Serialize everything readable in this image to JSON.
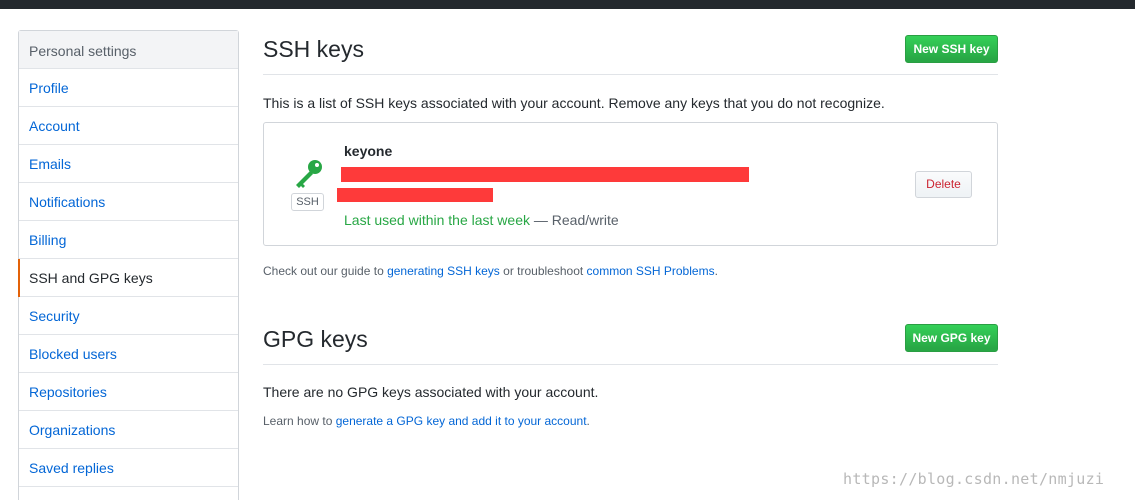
{
  "sidebar": {
    "header": "Personal settings",
    "items": [
      {
        "label": "Profile"
      },
      {
        "label": "Account"
      },
      {
        "label": "Emails"
      },
      {
        "label": "Notifications"
      },
      {
        "label": "Billing"
      },
      {
        "label": "SSH and GPG keys",
        "active": true
      },
      {
        "label": "Security"
      },
      {
        "label": "Blocked users"
      },
      {
        "label": "Repositories"
      },
      {
        "label": "Organizations"
      },
      {
        "label": "Saved replies"
      }
    ]
  },
  "ssh": {
    "title": "SSH keys",
    "new_button": "New SSH key",
    "description": "This is a list of SSH keys associated with your account. Remove any keys that you do not recognize.",
    "key": {
      "name": "keyone",
      "badge": "SSH",
      "last_used": "Last used within the last week",
      "separator": " — ",
      "access": "Read/write",
      "delete_label": "Delete"
    },
    "guide": {
      "prefix": "Check out our guide to ",
      "link1": "generating SSH keys",
      "middle": " or troubleshoot ",
      "link2": "common SSH Problems",
      "suffix": "."
    }
  },
  "gpg": {
    "title": "GPG keys",
    "new_button": "New GPG key",
    "empty": "There are no GPG keys associated with your account.",
    "learn": {
      "prefix": "Learn how to ",
      "link": "generate a GPG key and add it to your account",
      "suffix": "."
    }
  },
  "watermark": "https://blog.csdn.net/nmjuzi",
  "colors": {
    "link": "#0366d6",
    "green": "#28a745",
    "danger": "#cb2431",
    "active_border": "#e36209",
    "redaction": "#fe3a3a"
  }
}
